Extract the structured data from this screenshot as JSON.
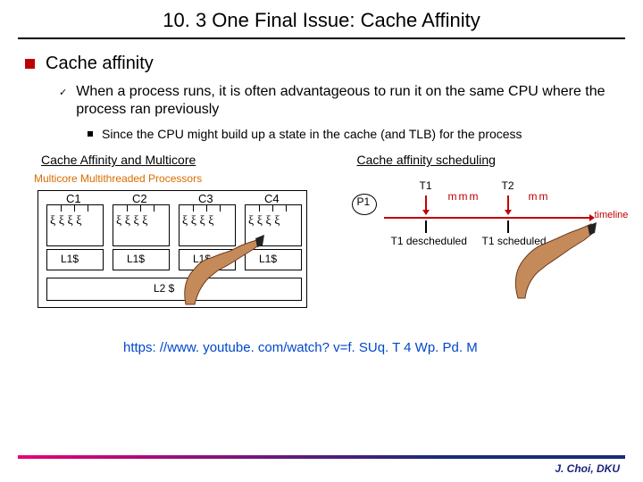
{
  "title": "10. 3 One Final Issue: Cache Affinity",
  "b1": "Cache affinity",
  "b2": "When a process runs, it is often advantageous to run it on the same CPU where the process ran previously",
  "b3": "Since the CPU might build up a state in the cache (and TLB) for the process",
  "left": {
    "heading": "Cache Affinity and Multicore",
    "sub": "Multicore Multithreaded Processors",
    "cores": [
      "C1",
      "C2",
      "C3",
      "C4"
    ],
    "l1": "L1$",
    "l2": "L2 $"
  },
  "right": {
    "heading": "Cache affinity scheduling",
    "proc": "P1",
    "t1": "T1",
    "t2": "T2",
    "axis": "timeline",
    "desched": "T1 descheduled",
    "sched": "T1 scheduled"
  },
  "link": "https: //www. youtube. com/watch? v=f. SUq. T 4 Wp. Pd. M",
  "footer": "J. Choi, DKU"
}
